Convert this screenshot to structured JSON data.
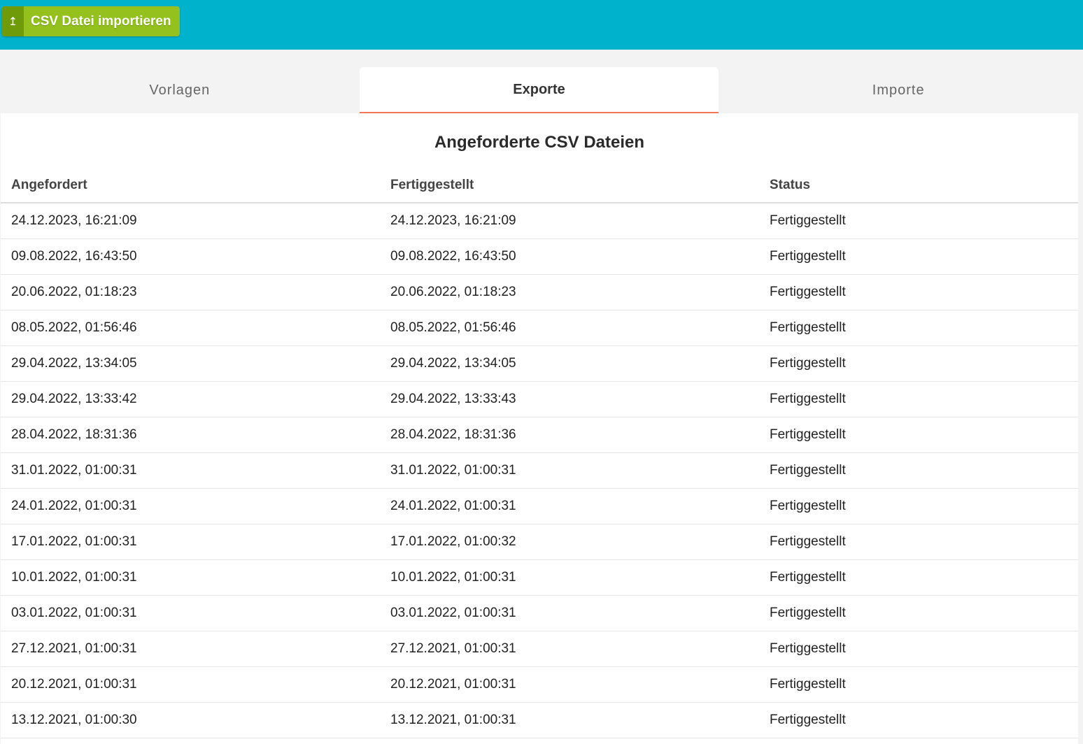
{
  "header": {
    "import_button": {
      "icon": "upload-icon",
      "icon_glyph": "↥",
      "label": "CSV Datei importieren"
    }
  },
  "tabs": [
    {
      "label": "Vorlagen",
      "active": false
    },
    {
      "label": "Exporte",
      "active": true
    },
    {
      "label": "Importe",
      "active": false
    }
  ],
  "panel": {
    "title": "Angeforderte CSV Dateien",
    "columns": [
      "Angefordert",
      "Fertiggestellt",
      "Status"
    ],
    "rows": [
      [
        "24.12.2023, 16:21:09",
        "24.12.2023, 16:21:09",
        "Fertiggestellt"
      ],
      [
        "09.08.2022, 16:43:50",
        "09.08.2022, 16:43:50",
        "Fertiggestellt"
      ],
      [
        "20.06.2022, 01:18:23",
        "20.06.2022, 01:18:23",
        "Fertiggestellt"
      ],
      [
        "08.05.2022, 01:56:46",
        "08.05.2022, 01:56:46",
        "Fertiggestellt"
      ],
      [
        "29.04.2022, 13:34:05",
        "29.04.2022, 13:34:05",
        "Fertiggestellt"
      ],
      [
        "29.04.2022, 13:33:42",
        "29.04.2022, 13:33:43",
        "Fertiggestellt"
      ],
      [
        "28.04.2022, 18:31:36",
        "28.04.2022, 18:31:36",
        "Fertiggestellt"
      ],
      [
        "31.01.2022, 01:00:31",
        "31.01.2022, 01:00:31",
        "Fertiggestellt"
      ],
      [
        "24.01.2022, 01:00:31",
        "24.01.2022, 01:00:31",
        "Fertiggestellt"
      ],
      [
        "17.01.2022, 01:00:31",
        "17.01.2022, 01:00:32",
        "Fertiggestellt"
      ],
      [
        "10.01.2022, 01:00:31",
        "10.01.2022, 01:00:31",
        "Fertiggestellt"
      ],
      [
        "03.01.2022, 01:00:31",
        "03.01.2022, 01:00:31",
        "Fertiggestellt"
      ],
      [
        "27.12.2021, 01:00:31",
        "27.12.2021, 01:00:31",
        "Fertiggestellt"
      ],
      [
        "20.12.2021, 01:00:31",
        "20.12.2021, 01:00:31",
        "Fertiggestellt"
      ],
      [
        "13.12.2021, 01:00:30",
        "13.12.2021, 01:00:31",
        "Fertiggestellt"
      ]
    ]
  },
  "colors": {
    "topbar": "#00b2cb",
    "button": "#95c11f",
    "button_icon_bg": "#6f9b0b",
    "tab_accent": "#f07859"
  }
}
